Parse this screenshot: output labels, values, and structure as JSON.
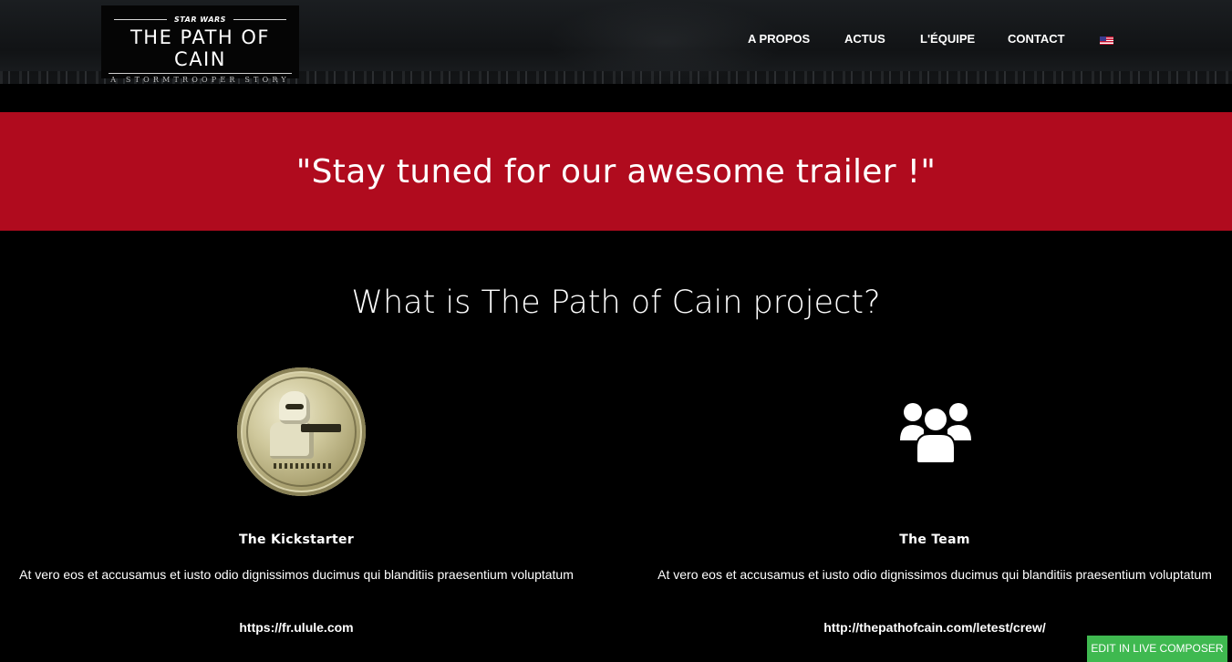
{
  "header": {
    "logo": {
      "brand": "STAR WARS",
      "title": "THE PATH OF CAIN",
      "subtitle": "A STORMTROOPER STORY"
    },
    "nav": [
      {
        "label": "A PROPOS"
      },
      {
        "label": "ACTUS"
      },
      {
        "label": "L'ÉQUIPE"
      },
      {
        "label": "CONTACT"
      }
    ],
    "language_flag": "us-flag-icon"
  },
  "banner": {
    "quote": "\"Stay tuned for our awesome trailer !\"",
    "color": "#b00b1e"
  },
  "section": {
    "title": "What is The Path of Cain project?"
  },
  "features": [
    {
      "icon": "stormtrooper-coin-icon",
      "title": "The Kickstarter",
      "text": "At vero eos et accusamus et iusto odio dignissimos ducimus qui blanditiis praesentium voluptatum",
      "link": "https://fr.ulule.com"
    },
    {
      "icon": "team-icon",
      "title": "The Team",
      "text": "At vero eos et accusamus et iusto odio dignissimos ducimus qui blanditiis praesentium voluptatum",
      "link": "http://thepathofcain.com/letest/crew/"
    }
  ],
  "composer_button": {
    "label": "EDIT IN LIVE COMPOSER",
    "color": "#3fb950"
  }
}
